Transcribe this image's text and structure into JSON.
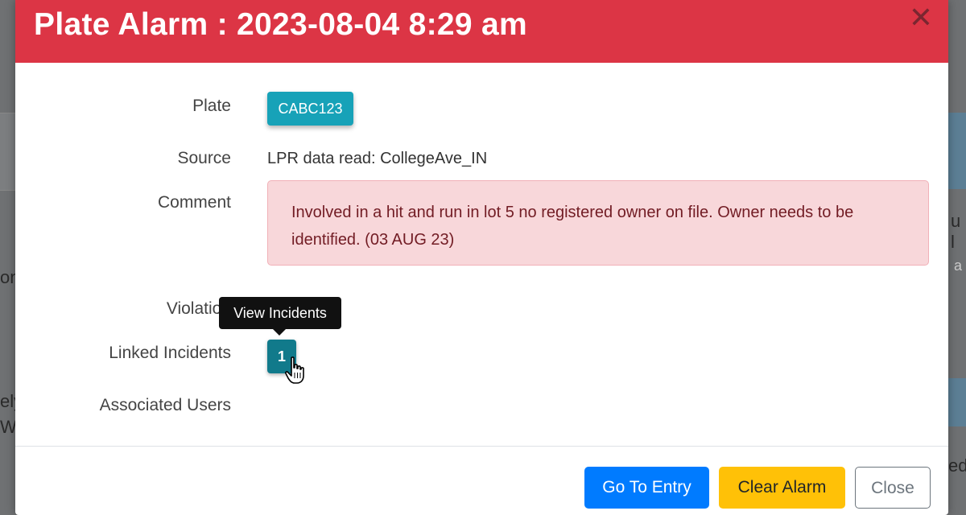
{
  "modal": {
    "title": "Plate Alarm : 2023-08-04 8:29 am",
    "close_glyph": "✕",
    "header_color": "#dc3545"
  },
  "fields": {
    "plate_label": "Plate",
    "plate_value": "CABC123",
    "source_label": "Source",
    "source_value": "LPR data read: CollegeAve_IN",
    "comment_label": "Comment",
    "comment_value": "Involved in a hit and run in lot 5 no registered owner on file. Owner needs to be identified. (03 AUG 23)",
    "violation_label": "Violation",
    "linked_incidents_label": "Linked Incidents",
    "linked_incidents_count": "1",
    "associated_users_label": "Associated Users"
  },
  "tooltip": {
    "text": "View Incidents"
  },
  "footer": {
    "go_to_entry": "Go To Entry",
    "clear_alarm": "Clear Alarm",
    "close": "Close"
  },
  "background_fragments": {
    "left_1": "on",
    "left_2": "ely",
    "left_3": "W",
    "right_1": "u l",
    "right_2": "a",
    "right_3": "ed"
  },
  "colors": {
    "danger": "#dc3545",
    "info": "#17a2b8",
    "primary": "#007bff",
    "warning": "#ffc107",
    "alert_bg": "#f8d7da"
  }
}
